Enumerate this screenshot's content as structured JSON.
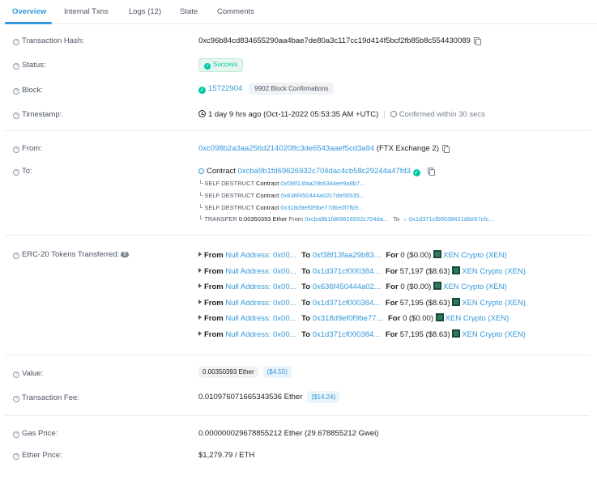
{
  "tabs": [
    {
      "label": "Overview"
    },
    {
      "label": "Internal Txns"
    },
    {
      "label": "Logs (12)"
    },
    {
      "label": "State"
    },
    {
      "label": "Comments"
    }
  ],
  "rows": {
    "tx_hash": {
      "label": "Transaction Hash:",
      "value": "0xc96b84cd834655290aa4bae7de80a3c117cc19d414f5bcf2fb85b8c554430089"
    },
    "status": {
      "label": "Status:",
      "value": "Success"
    },
    "block": {
      "label": "Block:",
      "value": "15722904",
      "confirmations": "9902 Block Confirmations"
    },
    "timestamp": {
      "label": "Timestamp:",
      "value": "1 day 9 hrs ago (Oct-11-2022 05:53:35 AM +UTC)",
      "sep": "|",
      "confirmed": "Confirmed within 30 secs"
    },
    "from": {
      "label": "From:",
      "address": "0xc098b2a3aa256d2140208c3de6543aaef5cd3a94",
      "name": "(FTX Exchange 2)"
    },
    "to": {
      "label": "To:",
      "prefix": "Contract",
      "address": "0xcba9b1fd69626932c704dac4cb58c29244a47fd3",
      "internal": [
        {
          "prefix": "└ SELF DESTRUCT",
          "kind": "Contract",
          "address": "0xf38f13faa29b6344ee9a8b7..."
        },
        {
          "prefix": "└ SELF DESTRUCT",
          "kind": "Contract",
          "address": "0x636f450444a02c7de06535..."
        },
        {
          "prefix": "└ SELF DESTRUCT",
          "kind": "Contract",
          "address": "0x318d9ef0f9be77d6e0f7fb9..."
        }
      ],
      "transfer": {
        "prefix": "└ TRANSFER",
        "amount": "0.00350393 Ether",
        "from_label": "From",
        "from_addr": "0xcba9b1fd69626932c704da...",
        "to_label": "To →",
        "to_addr": "0x1d371cf00038421d6e57cfc..."
      }
    },
    "erc20": {
      "label": "ERC-20 Tokens Transferred:",
      "count": "6",
      "transfers": [
        {
          "from_label": "From",
          "from": "Null Address: 0x00...",
          "to_label": "To",
          "to": "0xf38f13faa29b83...",
          "for_label": "For",
          "amount": "0",
          "usd": "($0.00)",
          "token": "XEN Crypto (XEN)"
        },
        {
          "from_label": "From",
          "from": "Null Address: 0x00...",
          "to_label": "To",
          "to": "0x1d371cf000384...",
          "for_label": "For",
          "amount": "57,197",
          "usd": "($8.63)",
          "token": "XEN Crypto (XEN)"
        },
        {
          "from_label": "From",
          "from": "Null Address: 0x00...",
          "to_label": "To",
          "to": "0x636f450444a02...",
          "for_label": "For",
          "amount": "0",
          "usd": "($0.00)",
          "token": "XEN Crypto (XEN)"
        },
        {
          "from_label": "From",
          "from": "Null Address: 0x00...",
          "to_label": "To",
          "to": "0x1d371cf000384...",
          "for_label": "For",
          "amount": "57,195",
          "usd": "($8.63)",
          "token": "XEN Crypto (XEN)"
        },
        {
          "from_label": "From",
          "from": "Null Address: 0x00...",
          "to_label": "To",
          "to": "0x318d9ef0f9be77...",
          "for_label": "For",
          "amount": "0",
          "usd": "($0.00)",
          "token": "XEN Crypto (XEN)"
        },
        {
          "from_label": "From",
          "from": "Null Address: 0x00...",
          "to_label": "To",
          "to": "0x1d371cf000384...",
          "for_label": "For",
          "amount": "57,195",
          "usd": "($8.63)",
          "token": "XEN Crypto (XEN)"
        }
      ]
    },
    "value": {
      "label": "Value:",
      "amount": "0.00350393 Ether",
      "usd": "($4.55)"
    },
    "fee": {
      "label": "Transaction Fee:",
      "amount": "0.010976071665343536 Ether",
      "usd": "($14.24)"
    },
    "gas": {
      "label": "Gas Price:",
      "value": "0.000000029678855212 Ether (29.678855212 Gwei)"
    },
    "ether_price": {
      "label": "Ether Price:",
      "value": "$1,279.79 / ETH"
    }
  },
  "colors": {
    "accent": "#3498db",
    "success": "#00c9a7",
    "text": "#1e2022",
    "muted": "#77838f"
  }
}
